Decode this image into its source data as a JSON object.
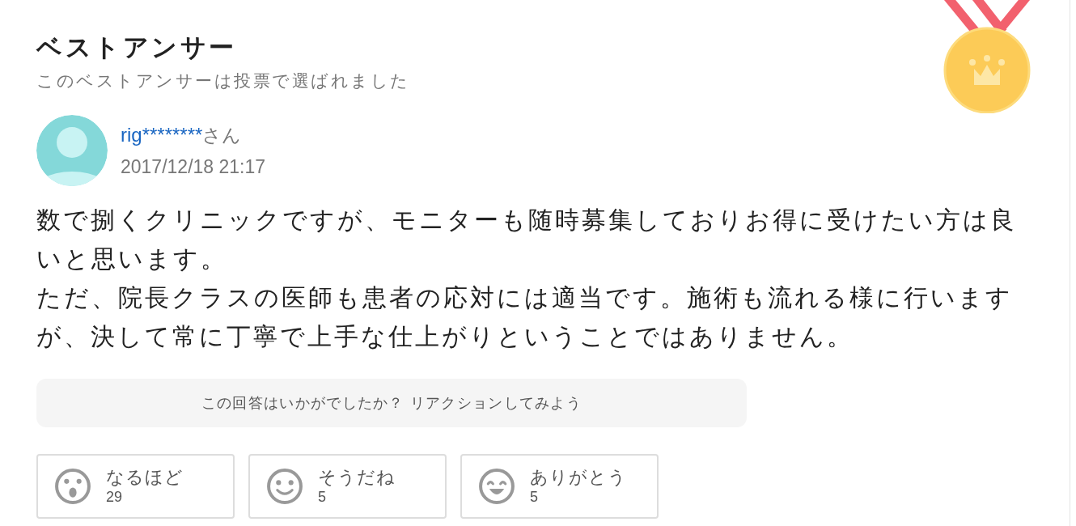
{
  "heading": "ベストアンサー",
  "subheading": "このベストアンサーは投票で選ばれました",
  "author": {
    "name": "rig********",
    "suffix": "さん",
    "date": "2017/12/18 21:17"
  },
  "body": [
    "数で捌くクリニックですが、モニターも随時募集しておりお得に受けたい方は良いと思います。",
    "ただ、院長クラスの医師も患者の応対には適当です。施術も流れる様に行いますが、決して常に丁寧で上手な仕上がりということではありません。"
  ],
  "prompt": "この回答はいかがでしたか？ リアクションしてみよう",
  "reactions": [
    {
      "kind": "surprised",
      "label": "なるほど",
      "count": "29"
    },
    {
      "kind": "smile",
      "label": "そうだね",
      "count": "5"
    },
    {
      "kind": "grin",
      "label": "ありがとう",
      "count": "5"
    }
  ]
}
